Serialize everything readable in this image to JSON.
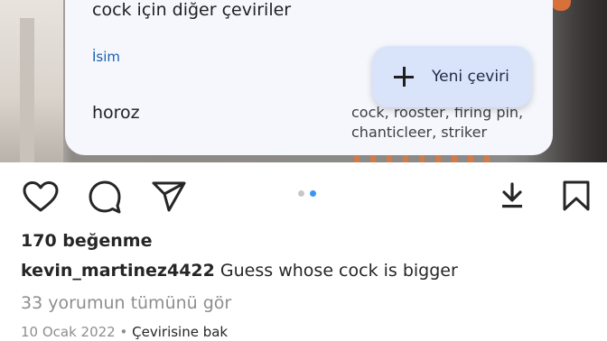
{
  "translate_card": {
    "title": "cock için diğer çeviriler",
    "part_of_speech": "İsim",
    "word": "horoz",
    "translations": "cock, rooster, firing pin, chanticleer, striker",
    "new_translation_button": "Yeni çeviri"
  },
  "post": {
    "likes": "170 beğenme",
    "username": "kevin_martinez4422",
    "caption": "Guess whose cock is bigger",
    "view_comments": "33 yorumun tümünü gör",
    "date": "10 Ocak 2022",
    "separator": "•",
    "see_translation": "Çevirisine bak",
    "carousel_active_index": 2,
    "carousel_count": 2
  },
  "icons": [
    "heart-icon",
    "comment-icon",
    "share-icon",
    "download-icon",
    "bookmark-icon",
    "plus-icon"
  ],
  "colors": {
    "accent_blue": "#3897f0",
    "card_bg": "#f5f7fc",
    "fab_bg": "#d9e4fb",
    "pos_label": "#1a5fb4"
  }
}
